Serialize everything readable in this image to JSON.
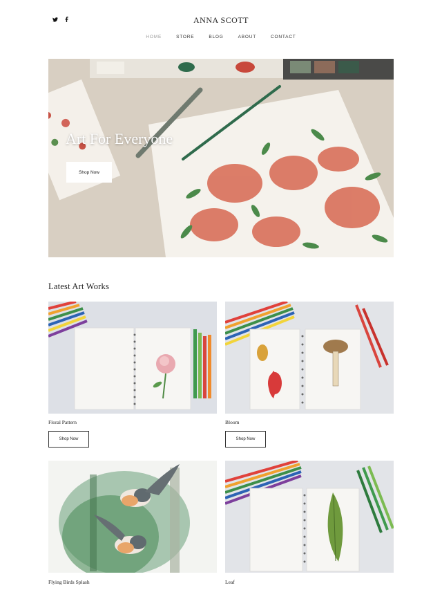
{
  "header": {
    "brand": "ANNA SCOTT",
    "social": {
      "twitter": "𝕥",
      "facebook": "f"
    }
  },
  "nav": {
    "items": [
      {
        "label": "HOME",
        "active": true
      },
      {
        "label": "STORE",
        "active": false
      },
      {
        "label": "BLOG",
        "active": false
      },
      {
        "label": "ABOUT",
        "active": false
      },
      {
        "label": "CONTACT",
        "active": false
      }
    ]
  },
  "hero": {
    "title": "Art For Everyone",
    "button": "Shop Now"
  },
  "section": {
    "title": "Latest Art Works"
  },
  "cards": [
    {
      "title": "Floral Pattern",
      "button": "Shop Now"
    },
    {
      "title": "Bloom",
      "button": "Shop Now"
    },
    {
      "title": "Flying Birds Splash"
    },
    {
      "title": "Leaf"
    }
  ],
  "colors": {
    "accent": "#222222",
    "nav_active": "#9a9a9a",
    "flower": "#d9705a",
    "leaf": "#4b8a4a"
  }
}
